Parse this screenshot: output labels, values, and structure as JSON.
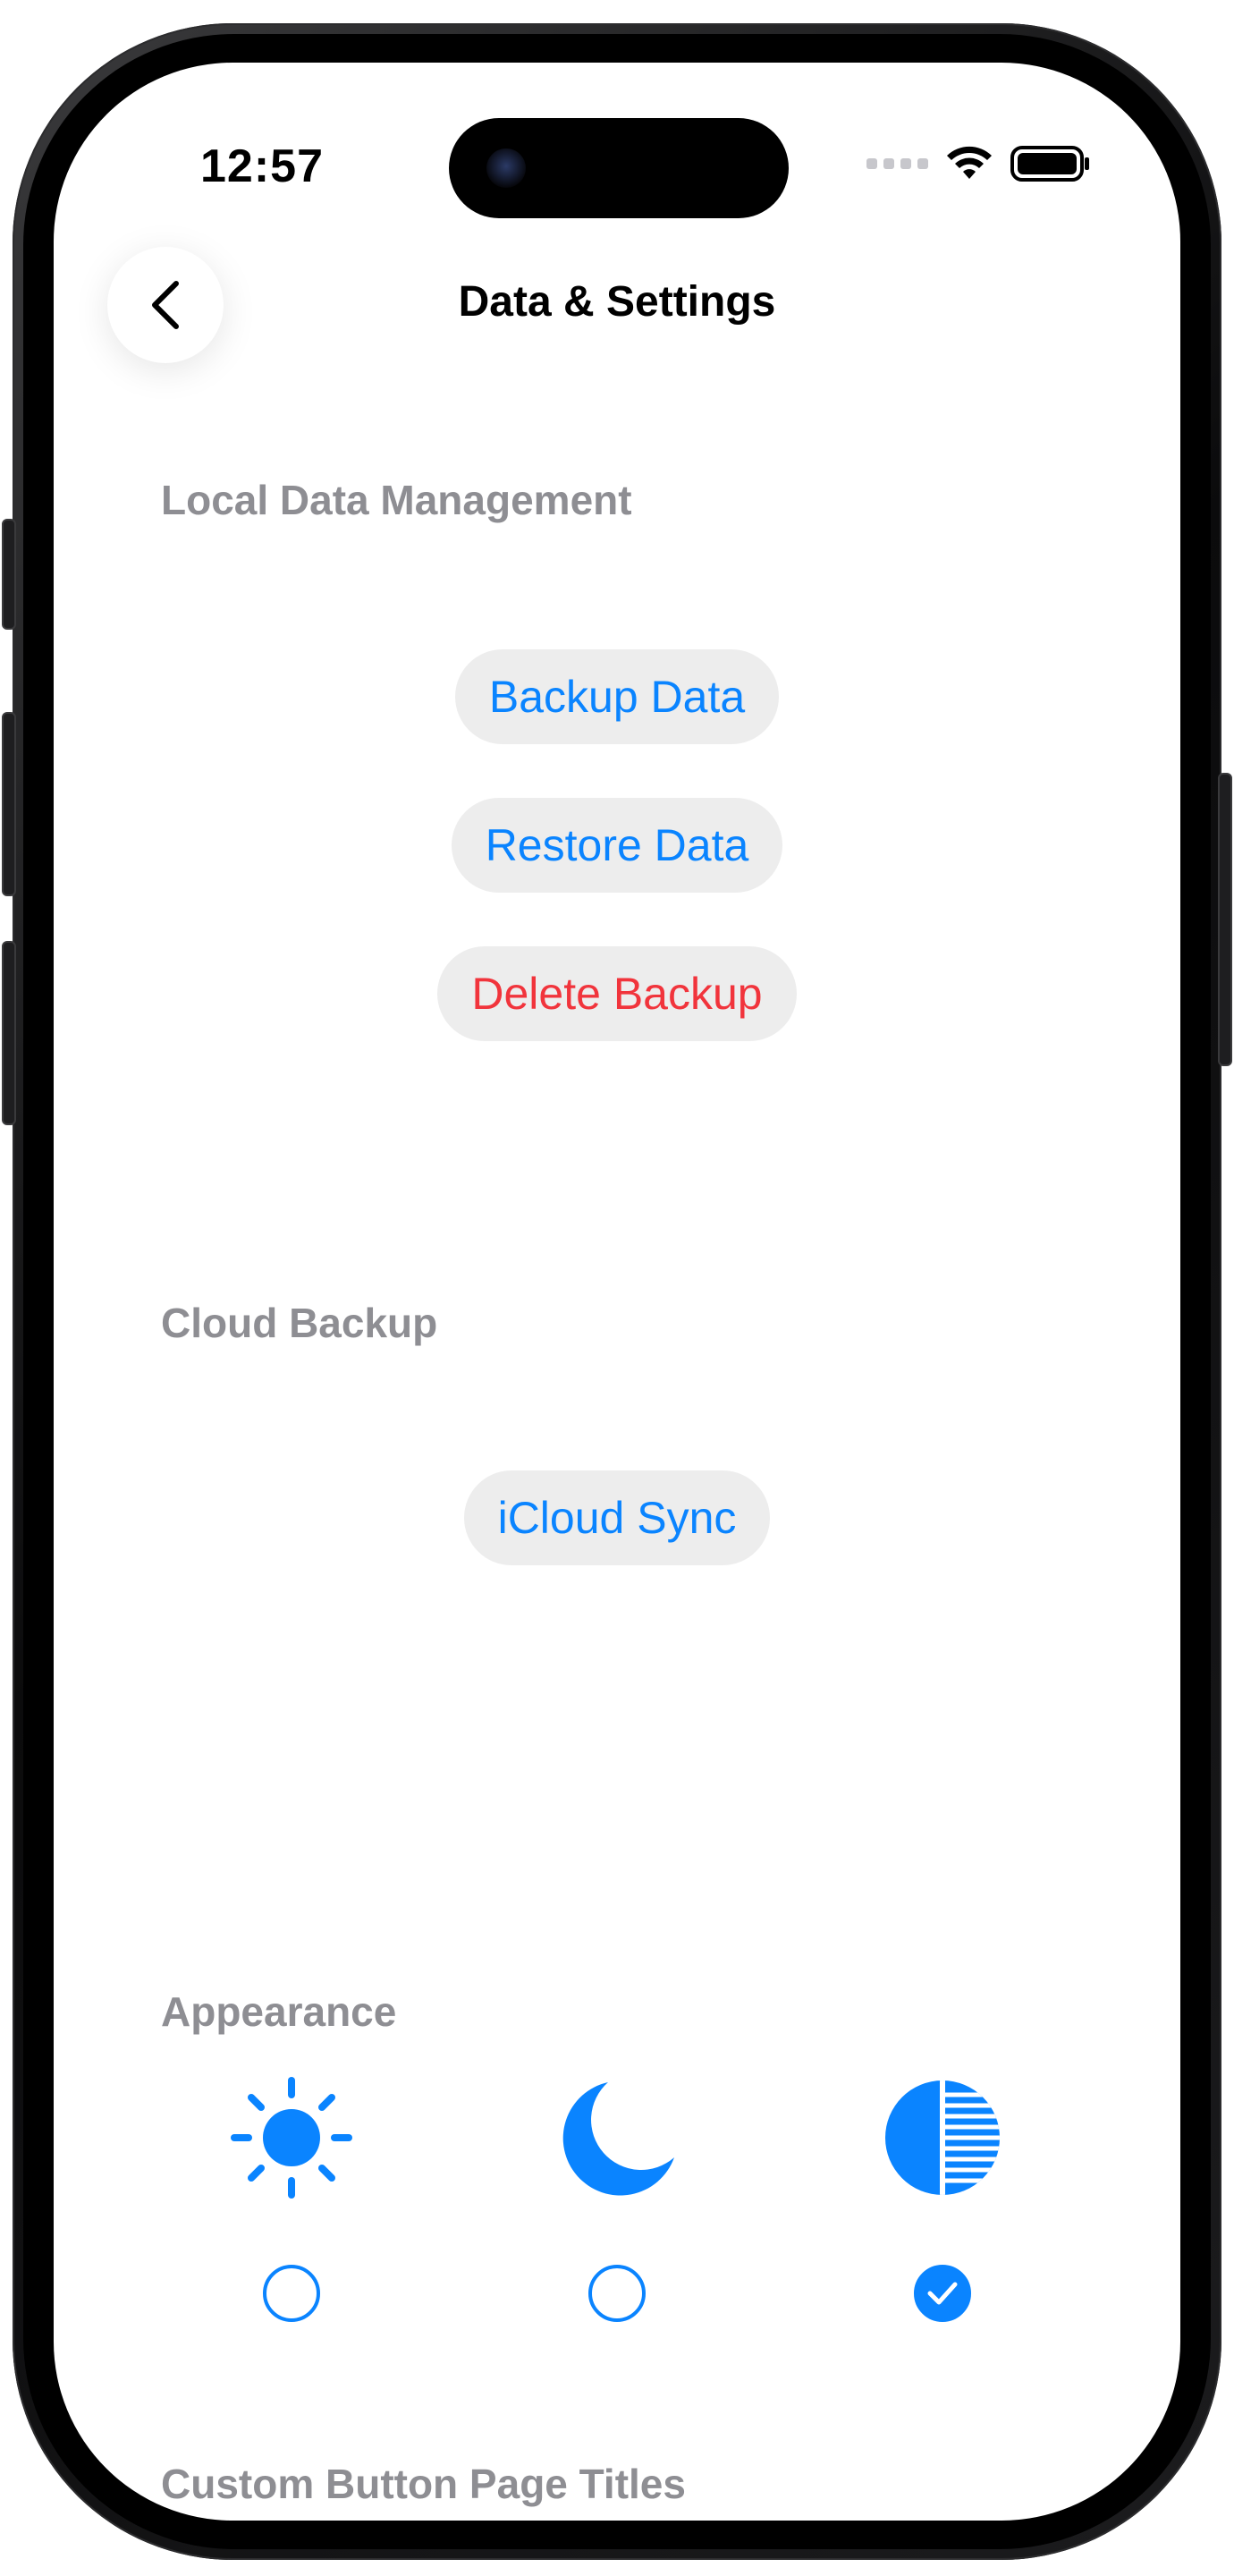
{
  "status_bar": {
    "time": "12:57"
  },
  "nav": {
    "title": "Data & Settings"
  },
  "local_data": {
    "header": "Local Data Management",
    "buttons": [
      {
        "label": "Backup Data",
        "color": "#0a84ff"
      },
      {
        "label": "Restore Data",
        "color": "#0a84ff"
      },
      {
        "label": "Delete Backup",
        "color": "#f1343c"
      }
    ]
  },
  "cloud_backup": {
    "header": "Cloud Backup",
    "button_label": "iCloud Sync"
  },
  "appearance": {
    "header": "Appearance",
    "options": [
      {
        "icon": "sun-icon",
        "selected": false
      },
      {
        "icon": "moon-icon",
        "selected": false
      },
      {
        "icon": "auto-contrast-icon",
        "selected": true
      }
    ]
  },
  "custom_titles": {
    "header": "Custom Button Page Titles"
  },
  "colors": {
    "accent": "#0a84ff",
    "destructive": "#f1343c",
    "section_header": "#8e8e93",
    "pill_background": "#ededed"
  }
}
